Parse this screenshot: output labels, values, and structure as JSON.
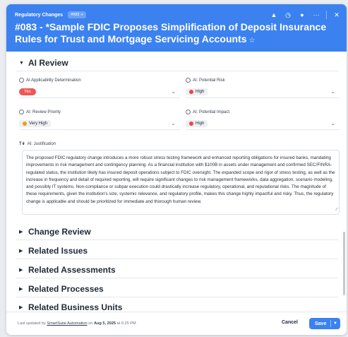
{
  "header": {
    "breadcrumb": "Regulatory Changes",
    "record_badge": "#083",
    "title": "#083 - *Sample FDIC Proposes Simplification of Deposit Insurance Rules for Trust and Mortgage Servicing Accounts",
    "icons": [
      "bell-icon",
      "clock-icon",
      "comment-icon",
      "more-icon",
      "close-icon"
    ],
    "background_color": "#3b82f0"
  },
  "ai_review": {
    "title": "AI Review",
    "applicability": {
      "label": "AI Applicability Determination",
      "value": "Yes"
    },
    "potential_risk": {
      "label": "AI: Potential Risk",
      "value": "High"
    },
    "review_priority": {
      "label": "AI: Review Priority",
      "value": "Very High"
    },
    "potential_impact": {
      "label": "AI: Potential Impact",
      "value": "High"
    },
    "justification": {
      "label": "AI: Justification",
      "text": "The proposed FDIC regulatory change introduces a more robust stress testing framework and enhanced reporting obligations for insured banks, mandating improvements in risk management and contingency planning. As a financial institution with $100B in assets under management and confirmed SEC/FINRA-regulated status, the institution likely has insured deposit operations subject to FDIC oversight. The expanded scope and rigor of stress testing, as well as the increase in frequency and detail of required reporting, will require significant changes to risk management frameworks, data aggregation, scenario modeling, and possibly IT systems. Non-compliance or subpar execution could drastically increase regulatory, operational, and reputational risks. The magnitude of these requirements, given the institution's size, systemic relevance, and regulatory profile, makes this change highly impactful and risky. Thus, the regulatory change is applicable and should be prioritized for immediate and thorough human review."
    }
  },
  "sections": [
    {
      "label": "Change Review"
    },
    {
      "label": "Related Issues"
    },
    {
      "label": "Related Assessments"
    },
    {
      "label": "Related Processes"
    },
    {
      "label": "Related Business Units"
    }
  ],
  "footer": {
    "updated_prefix": "Last updated by",
    "updated_user": "SmartSuite Automation",
    "updated_on": "on",
    "updated_date": "Aug 5, 2025",
    "updated_time": "at 6:25 PM",
    "cancel_label": "Cancel",
    "save_label": "Save"
  },
  "colors": {
    "accent": "#3b82f0",
    "yes_pill": "#f05656",
    "high_dot": "#ef4444",
    "very_high_dot": "#f59e0b"
  }
}
